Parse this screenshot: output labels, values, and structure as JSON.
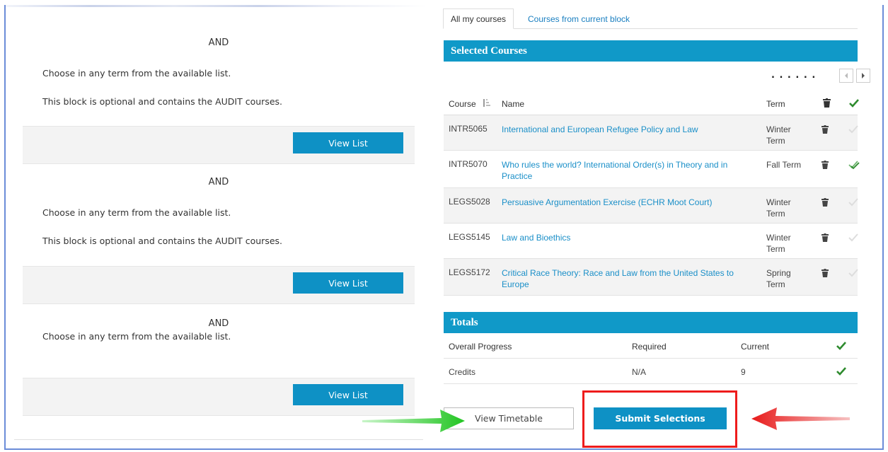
{
  "left_panel": {
    "blocks": [
      {
        "and": "AND",
        "line1": "Choose in any term from the available list.",
        "line2": "This block is optional and contains the AUDIT courses.",
        "button": "View List"
      },
      {
        "and": "AND",
        "line1": "Choose in any term from the available list.",
        "line2": "This block is optional and contains the AUDIT courses.",
        "button": "View List"
      },
      {
        "and": "AND",
        "line1": "Choose in any term from the available list.",
        "button": "View List"
      }
    ]
  },
  "tabs": {
    "all": "All my courses",
    "current": "Courses from current block"
  },
  "selected": {
    "title": "Selected Courses",
    "pager_dots": ". . . . . .",
    "headers": {
      "course": "Course",
      "name": "Name",
      "term": "Term"
    },
    "rows": [
      {
        "code": "INTR5065",
        "name": "International and European Refugee Policy and Law",
        "term": "Winter Term",
        "checked": false
      },
      {
        "code": "INTR5070",
        "name": "Who rules the world? International Order(s) in Theory and in Practice",
        "term": "Fall Term",
        "checked": true
      },
      {
        "code": "LEGS5028",
        "name": "Persuasive Argumentation Exercise (ECHR Moot Court)",
        "term": "Winter Term",
        "checked": false
      },
      {
        "code": "LEGS5145",
        "name": "Law and Bioethics",
        "term": "Winter Term",
        "checked": false
      },
      {
        "code": "LEGS5172",
        "name": "Critical Race Theory: Race and Law from the United States to Europe",
        "term": "Spring Term",
        "checked": false
      }
    ]
  },
  "totals": {
    "title": "Totals",
    "headers": {
      "progress": "Overall Progress",
      "required": "Required",
      "current": "Current"
    },
    "row": {
      "label": "Credits",
      "required": "N/A",
      "current": "9"
    }
  },
  "buttons": {
    "timetable": "View Timetable",
    "submit": "Submit Selections"
  },
  "colors": {
    "accent": "#1099c8",
    "link": "#1a8fc8",
    "check": "#2e8b2e",
    "highlight": "#ee1c1c",
    "green_arrow": "#2ecc2e",
    "red_arrow": "#e81b1b"
  }
}
